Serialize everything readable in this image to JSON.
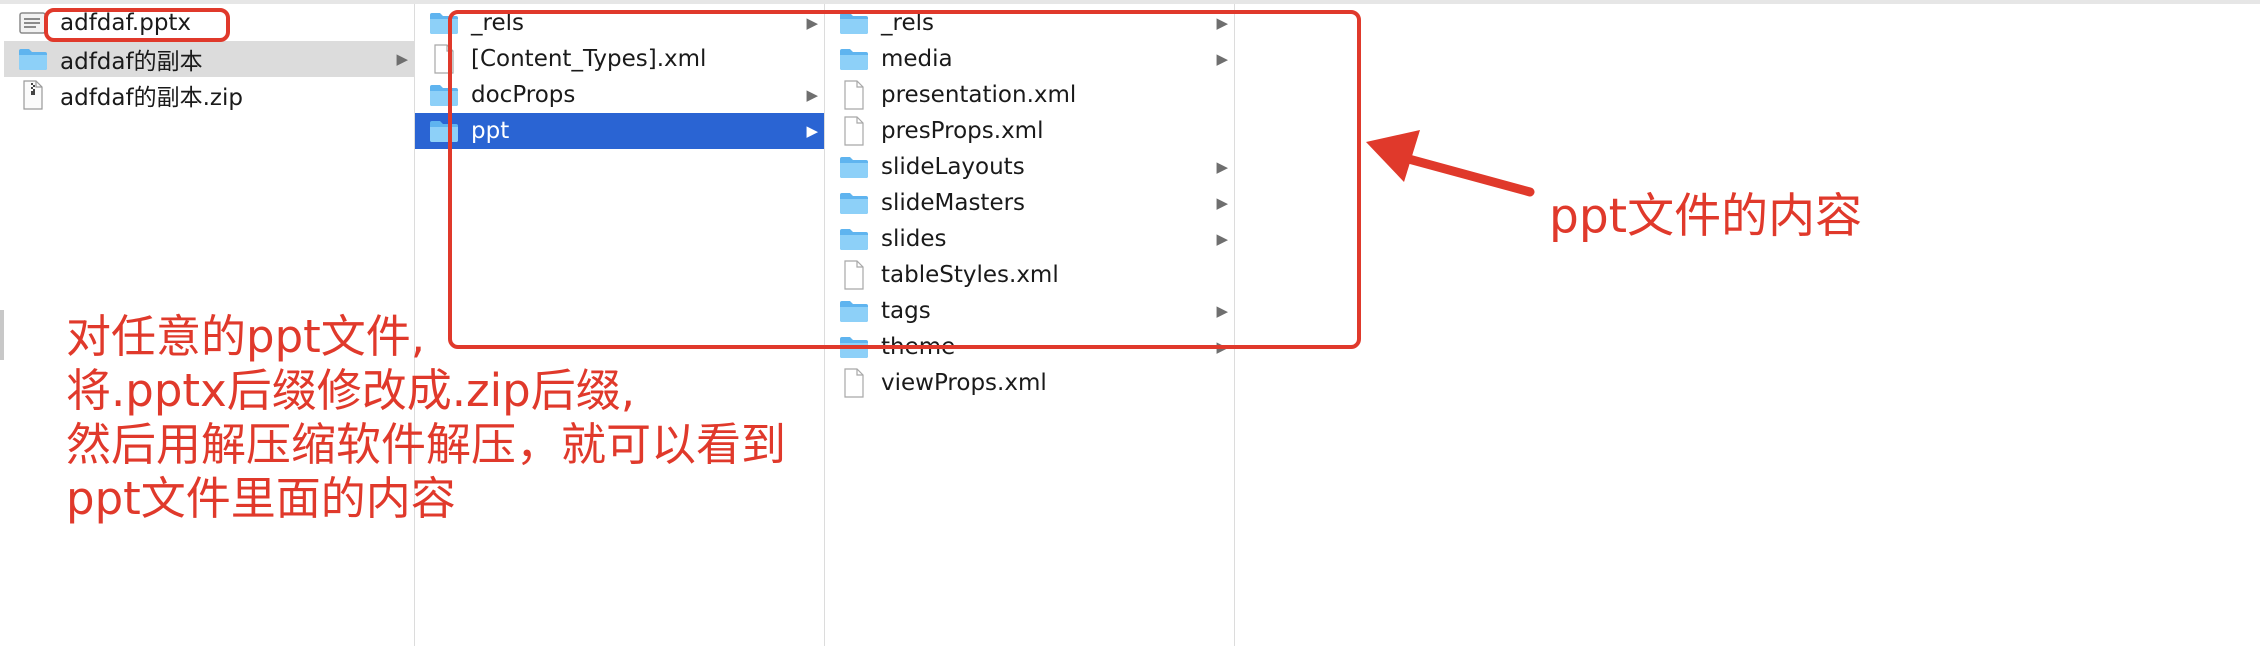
{
  "col1": [
    {
      "name": "adfdaf.pptx",
      "icon": "pptx-file-icon",
      "state": "normal",
      "arrow": false
    },
    {
      "name": "adfdaf的副本",
      "icon": "folder-icon",
      "state": "grey",
      "arrow": true
    },
    {
      "name": "adfdaf的副本.zip",
      "icon": "zip-file-icon",
      "state": "normal",
      "arrow": false
    }
  ],
  "col2": [
    {
      "name": "_rels",
      "icon": "folder-icon",
      "state": "normal",
      "arrow": true
    },
    {
      "name": "[Content_Types].xml",
      "icon": "file-icon",
      "state": "normal",
      "arrow": false
    },
    {
      "name": "docProps",
      "icon": "folder-icon",
      "state": "normal",
      "arrow": true
    },
    {
      "name": "ppt",
      "icon": "folder-icon",
      "state": "blue",
      "arrow": true
    }
  ],
  "col3": [
    {
      "name": "_rels",
      "icon": "folder-icon",
      "arrow": true
    },
    {
      "name": "media",
      "icon": "folder-icon",
      "arrow": true
    },
    {
      "name": "presentation.xml",
      "icon": "file-icon",
      "arrow": false
    },
    {
      "name": "presProps.xml",
      "icon": "file-icon",
      "arrow": false
    },
    {
      "name": "slideLayouts",
      "icon": "folder-icon",
      "arrow": true
    },
    {
      "name": "slideMasters",
      "icon": "folder-icon",
      "arrow": true
    },
    {
      "name": "slides",
      "icon": "folder-icon",
      "arrow": true
    },
    {
      "name": "tableStyles.xml",
      "icon": "file-icon",
      "arrow": false
    },
    {
      "name": "tags",
      "icon": "folder-icon",
      "arrow": true
    },
    {
      "name": "theme",
      "icon": "folder-icon",
      "arrow": true
    },
    {
      "name": "viewProps.xml",
      "icon": "file-icon",
      "arrow": false
    }
  ],
  "annotations": {
    "note_lines": [
      "对任意的ppt文件,",
      "将.pptx后缀修改成.zip后缀,",
      "然后用解压缩软件解压，就可以看到",
      "ppt文件里面的内容"
    ],
    "callout": "ppt文件的内容"
  },
  "colors": {
    "annotation_red": "#e0392b",
    "selection_blue": "#2a64d3",
    "inactive_selection_grey": "#dcdcdc",
    "folder_blue": "#7cc4f4"
  }
}
